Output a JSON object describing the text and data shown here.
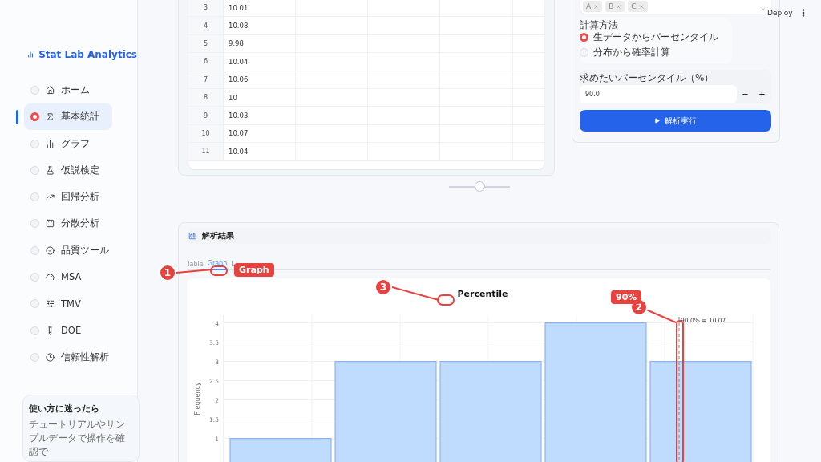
{
  "header": {
    "deploy": "Deploy"
  },
  "sidebar": {
    "brand": "Stat Lab Analytics",
    "items": [
      {
        "label": "ホーム",
        "selected": false
      },
      {
        "label": "基本統計",
        "selected": true
      },
      {
        "label": "グラフ",
        "selected": false
      },
      {
        "label": "仮説検定",
        "selected": false
      },
      {
        "label": "回帰分析",
        "selected": false
      },
      {
        "label": "分散分析",
        "selected": false
      },
      {
        "label": "品質ツール",
        "selected": false
      },
      {
        "label": "MSA",
        "selected": false
      },
      {
        "label": "TMV",
        "selected": false
      },
      {
        "label": "DOE",
        "selected": false
      },
      {
        "label": "信頼性解析",
        "selected": false
      }
    ],
    "help": {
      "title": "使い方に迷ったら",
      "text": "チュートリアルやサンプルデータで操作を確認で"
    }
  },
  "data_table": {
    "rows": [
      {
        "index": "3",
        "value": "10.01"
      },
      {
        "index": "4",
        "value": "10.08"
      },
      {
        "index": "5",
        "value": "9.98"
      },
      {
        "index": "6",
        "value": "10.04"
      },
      {
        "index": "7",
        "value": "10.06"
      },
      {
        "index": "8",
        "value": "10"
      },
      {
        "index": "9",
        "value": "10.03"
      },
      {
        "index": "10",
        "value": "10.07"
      },
      {
        "index": "11",
        "value": "10.04"
      }
    ]
  },
  "settings": {
    "chips": [
      "A",
      "B",
      "C"
    ],
    "method_label": "計算方法",
    "methods": [
      {
        "label": "生データからパーセンタイル",
        "selected": true
      },
      {
        "label": "分布から確率計算",
        "selected": false
      }
    ],
    "percentile_label": "求めたいパーセンタイル（%）",
    "percentile_value": "90.0",
    "minus": "−",
    "plus": "+",
    "run_button": "解析実行"
  },
  "splitter": {
    "level": 0.5
  },
  "results": {
    "title": "解析結果",
    "tabs": [
      {
        "label": "Table",
        "selected": false
      },
      {
        "label": "Graph",
        "selected": true
      },
      {
        "label": "L",
        "selected": false
      }
    ],
    "chart_data": {
      "type": "bar",
      "title": "Percentile",
      "ylabel": "Frequency",
      "values": [
        1,
        3,
        3,
        4,
        3
      ],
      "yticks": [
        1,
        1.5,
        2,
        2.5,
        3,
        3.5,
        4
      ],
      "ylim": [
        0,
        4.2
      ],
      "grid": true,
      "annotations": [
        "90.0% = 10.07"
      ]
    }
  },
  "callouts": [
    {
      "number": "1",
      "label": "Graph"
    },
    {
      "number": "3"
    },
    {
      "number": "2",
      "label": "90%"
    }
  ]
}
